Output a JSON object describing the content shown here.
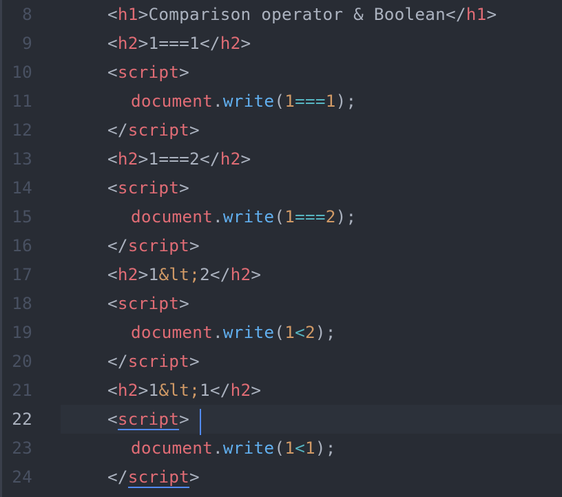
{
  "editor": {
    "colors": {
      "background": "#282c34",
      "tag": "#e06c75",
      "number": "#d19a66",
      "operator": "#56b6c2",
      "function": "#61afef",
      "text": "#abb2bf",
      "line_number": "#495162",
      "cursor": "#528bff"
    },
    "cursor_line_number": "22",
    "lines": [
      {
        "n": "8",
        "t1": "h1",
        "text": "Comparison operator & Boolean",
        "t2": "h1"
      },
      {
        "n": "9",
        "t1": "h2",
        "text": "1===1",
        "t2": "h2"
      },
      {
        "n": "10",
        "tag": "script"
      },
      {
        "n": "11",
        "obj": "document",
        "dot": ".",
        "fn": "write",
        "open": "(",
        "a": "1",
        "op": "===",
        "b": "1",
        "close": ");"
      },
      {
        "n": "12",
        "tag": "script"
      },
      {
        "n": "13",
        "t1": "h2",
        "text": "1===2",
        "t2": "h2"
      },
      {
        "n": "14",
        "tag": "script"
      },
      {
        "n": "15",
        "obj": "document",
        "dot": ".",
        "fn": "write",
        "open": "(",
        "a": "1",
        "op": "===",
        "b": "2",
        "close": ");"
      },
      {
        "n": "16",
        "tag": "script"
      },
      {
        "n": "17",
        "t1": "h2",
        "a": "1",
        "ent": "&lt;",
        "b": "2",
        "t2": "h2"
      },
      {
        "n": "18",
        "tag": "script"
      },
      {
        "n": "19",
        "obj": "document",
        "dot": ".",
        "fn": "write",
        "open": "(",
        "a": "1",
        "op": "<",
        "b": "2",
        "close": ");"
      },
      {
        "n": "20",
        "tag": "script"
      },
      {
        "n": "21",
        "t1": "h2",
        "a": "1",
        "ent": "&lt;",
        "b": "1",
        "t2": "h2"
      },
      {
        "n": "22",
        "tag": "script"
      },
      {
        "n": "23",
        "obj": "document",
        "dot": ".",
        "fn": "write",
        "open": "(",
        "a": "1",
        "op": "<",
        "b": "1",
        "close": ");"
      },
      {
        "n": "24",
        "tag": "script"
      }
    ]
  }
}
